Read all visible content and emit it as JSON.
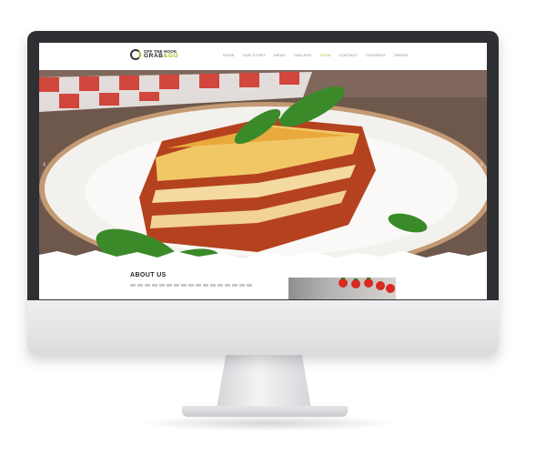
{
  "site": {
    "logo": {
      "line1": "OFF THE HOOK",
      "line2_main": "GRAB",
      "line2_mid": "&",
      "line2_accent": "GO"
    },
    "nav": [
      "HOME",
      "OUR STORY",
      "MENU",
      "GALLERY",
      "TEAM",
      "CONTACT",
      "CATERING",
      "ORDER"
    ],
    "active_nav_index": 4,
    "about_title": "ABOUT US"
  },
  "colors": {
    "accent": "#9bbf2b",
    "bezel": "#2f3033"
  },
  "icons": {
    "prev": "chevron-left-icon",
    "next": "chevron-right-icon"
  }
}
